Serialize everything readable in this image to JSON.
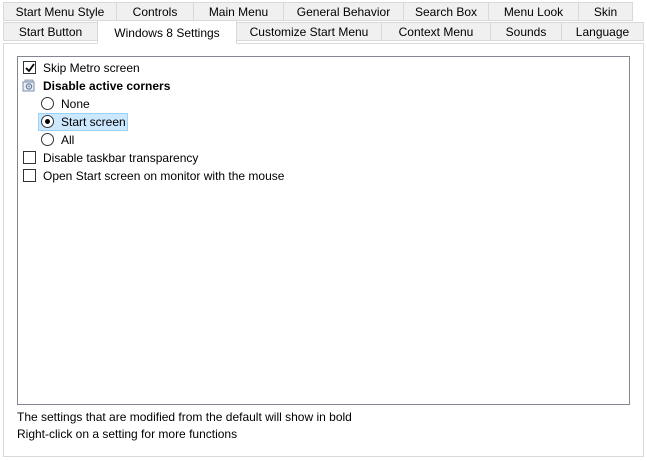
{
  "tabs_top": [
    {
      "label": "Start Menu Style"
    },
    {
      "label": "Controls"
    },
    {
      "label": "Main Menu"
    },
    {
      "label": "General Behavior"
    },
    {
      "label": "Search Box"
    },
    {
      "label": "Menu Look"
    },
    {
      "label": "Skin"
    }
  ],
  "tabs_bottom": [
    {
      "label": "Start Button"
    },
    {
      "label": "Windows 8 Settings"
    },
    {
      "label": "Customize Start Menu"
    },
    {
      "label": "Context Menu"
    },
    {
      "label": "Sounds"
    },
    {
      "label": "Language"
    }
  ],
  "selected_tab": "Windows 8 Settings",
  "settings": {
    "skip_metro": {
      "label": "Skip Metro screen",
      "checked": true
    },
    "disable_corners": {
      "label": "Disable active corners",
      "options": [
        {
          "label": "None",
          "selected": false
        },
        {
          "label": "Start screen",
          "selected": true
        },
        {
          "label": "All",
          "selected": false
        }
      ]
    },
    "disable_taskbar_transparency": {
      "label": "Disable taskbar transparency",
      "checked": false
    },
    "open_start_on_monitor": {
      "label": "Open Start screen on monitor with the mouse",
      "checked": false
    }
  },
  "footer": {
    "line1": "The settings that are modified from the default will show in bold",
    "line2": "Right-click on a setting for more functions"
  },
  "colors": {
    "selection_bg": "#cce8ff",
    "selection_border": "#99d1ff",
    "tab_bg": "#f0f0f0"
  }
}
